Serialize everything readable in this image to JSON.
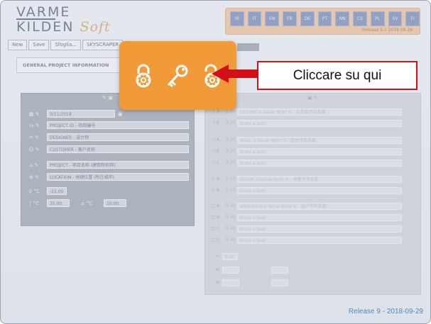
{
  "logo": {
    "line1": "VARME",
    "line2": "KILDEN",
    "soft": "Soft"
  },
  "languages": [
    "IS",
    "IT",
    "EN",
    "FR",
    "DE",
    "PT",
    "NN",
    "CS",
    "PL",
    "SV",
    "FI"
  ],
  "lang_release": "Release 9.1 2018.09.29",
  "toolbar": {
    "new": "New",
    "save": "Save",
    "browse": "Sfoglia...",
    "project": "SKYSCRAPER"
  },
  "tab": "GENERAL PROJECT INFORMATION",
  "left_panel": {
    "header": "✎ ▣",
    "date": "9/11/2018",
    "project_id": "PROJECT ID - 项目编号",
    "designer": "DESIGNER - 设计师",
    "customer": "CUSTOMER - 客户名称",
    "project": "PROJECT - 项目名称 (建筑物名称)",
    "location": "LOCATION - 地理位置 (所在城市)",
    "temp_label": "°C",
    "temp_value": "-15.00",
    "val1": "35.00",
    "val2_label": "± °C",
    "val2": "10.00"
  },
  "right_panel": {
    "header": "▣ ✎",
    "rows": [
      {
        "lbl": "T A",
        "val": "0.20",
        "text": "CEILING U-Value W/m² K - 天花板传热系数"
      },
      {
        "lbl": "T B",
        "val": "0.20",
        "text": "Enter a text"
      },
      {
        "lbl": "⊣ A",
        "val": "0.20",
        "text": "WALL U-Value W/m² K - 墙体传热系数"
      },
      {
        "lbl": "⊣ B",
        "val": "0.20",
        "text": "Enter a text"
      },
      {
        "lbl": "⊣ C",
        "val": "0.20",
        "text": "Enter a text"
      },
      {
        "lbl": "⊥ A",
        "val": "0.20",
        "text": "FLOOR U-Value W/m² K - 地板传热系数"
      },
      {
        "lbl": "⊥ B",
        "val": "0.20",
        "text": "Enter a text"
      },
      {
        "lbl": "□ A",
        "val": "0.20",
        "text": "WINDOWS U-Value W/m² K - 窗户传热系数"
      },
      {
        "lbl": "□ B",
        "val": "0.20",
        "text": "Enter a text"
      },
      {
        "lbl": "□ C",
        "val": "0.20",
        "text": "Enter a text"
      },
      {
        "lbl": "□ D",
        "val": "0.20",
        "text": "Enter a text"
      }
    ],
    "misc": "0.10"
  },
  "callout": "Cliccare su qui",
  "release": "Release 9 - 2018-09-29",
  "colors": {
    "accent": "#f19a38",
    "callout_border": "#d3101a",
    "release_text": "#4d8bbf"
  }
}
